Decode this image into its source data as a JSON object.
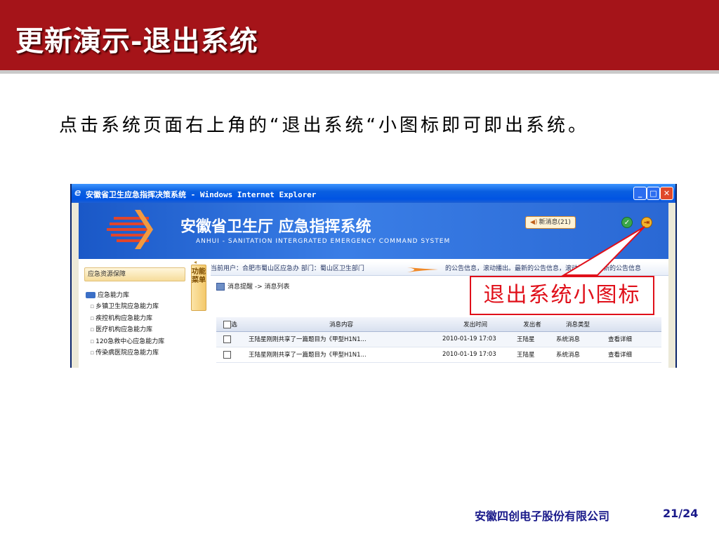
{
  "slide": {
    "title": "更新演示-退出系统",
    "instruction": "点击系统页面右上角的“退出系统“小图标即可即出系统。",
    "callout_label": "退出系统小图标",
    "company": "安徽四创电子股份有限公司",
    "page_number": "21/24"
  },
  "browser": {
    "window_title": "安徽省卫生应急指挥决策系统 - Windows Internet Explorer",
    "app_title": "安徽省卫生厅  应急指挥系统",
    "app_subtitle": "ANHUI - SANITATION INTERGRATED EMERGENCY COMMAND SYSTEM",
    "new_message_label": "新消息(21)",
    "side_panel_title": "应急资源保障",
    "tree_root": "应急能力库",
    "tree_items": [
      "乡镇卫生院应急能力库",
      "疾控机构应急能力库",
      "医疗机构应急能力库",
      "120急救中心应急能力库",
      "传染病医院应急能力库"
    ],
    "side_tab": "功能菜单",
    "current_user_info": "当前用户：合肥市蜀山区应急办   部门：蜀山区卫生部门",
    "marquee_text": "的公告信息，滚动播出。最新的公告信息，滚动播出。最新的公告信息",
    "breadcrumb": "消息提醒 -> 消息列表",
    "table": {
      "headers": [
        "选",
        "消息内容",
        "发出时间",
        "发出者",
        "消息类型",
        ""
      ],
      "rows": [
        [
          "王陆星刚刚共享了一篇题目为《甲型H1N1...",
          "2010-01-19 17:03",
          "王陆星",
          "系统消息",
          "查看详细"
        ],
        [
          "王陆星刚刚共享了一篇题目为《甲型H1N1...",
          "2010-01-19 17:03",
          "王陆星",
          "系统消息",
          "查看详细"
        ]
      ]
    }
  },
  "colors": {
    "header_red": "#a51419",
    "callout_red": "#e0101a",
    "company_blue": "#1a1a8a"
  }
}
